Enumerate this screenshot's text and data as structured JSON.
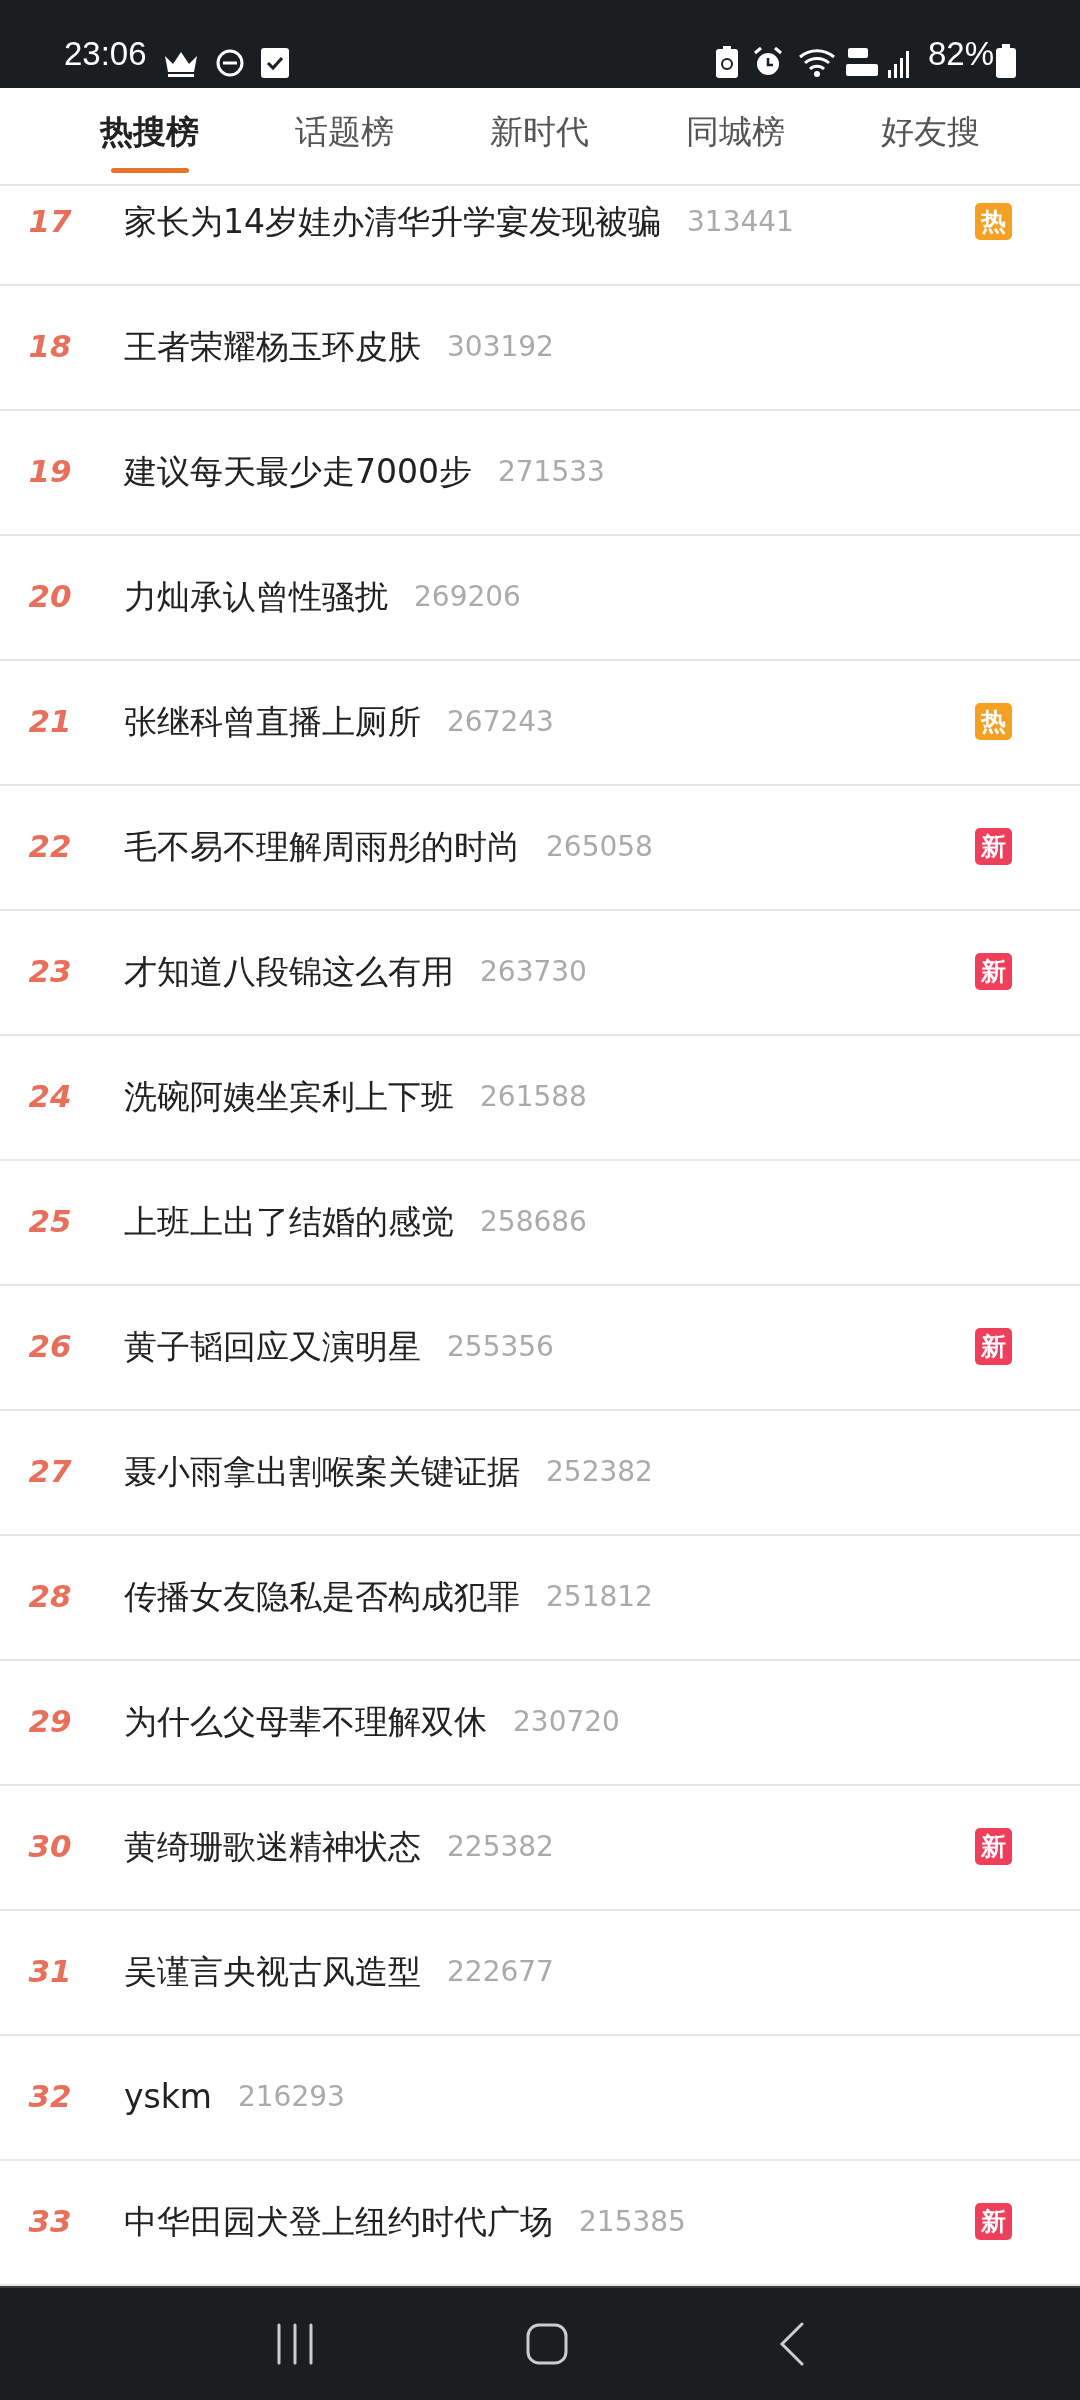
{
  "status_bar": {
    "time": "23:06",
    "battery": "82%"
  },
  "tabs": [
    {
      "label": "热搜榜",
      "selected": true
    },
    {
      "label": "话题榜",
      "selected": false
    },
    {
      "label": "新时代",
      "selected": false
    },
    {
      "label": "同城榜",
      "selected": false
    },
    {
      "label": "好友搜",
      "selected": false
    }
  ],
  "rows": [
    {
      "rank": "17",
      "title": "家长为14岁娃办清华升学宴发现被骗",
      "count": "313441",
      "badge": {
        "kind": "hot",
        "text": "热"
      }
    },
    {
      "rank": "18",
      "title": "王者荣耀杨玉环皮肤",
      "count": "303192"
    },
    {
      "rank": "19",
      "title": "建议每天最少走7000步",
      "count": "271533"
    },
    {
      "rank": "20",
      "title": "力灿承认曾性骚扰",
      "count": "269206"
    },
    {
      "rank": "21",
      "title": "张继科曾直播上厕所",
      "count": "267243",
      "badge": {
        "kind": "hot",
        "text": "热"
      }
    },
    {
      "rank": "22",
      "title": "毛不易不理解周雨彤的时尚",
      "count": "265058",
      "badge": {
        "kind": "new",
        "text": "新"
      }
    },
    {
      "rank": "23",
      "title": "才知道八段锦这么有用",
      "count": "263730",
      "badge": {
        "kind": "new",
        "text": "新"
      }
    },
    {
      "rank": "24",
      "title": "洗碗阿姨坐宾利上下班",
      "count": "261588"
    },
    {
      "rank": "25",
      "title": "上班上出了结婚的感觉",
      "count": "258686"
    },
    {
      "rank": "26",
      "title": "黄子韬回应又演明星",
      "count": "255356",
      "badge": {
        "kind": "new",
        "text": "新"
      }
    },
    {
      "rank": "27",
      "title": "聂小雨拿出割喉案关键证据",
      "count": "252382"
    },
    {
      "rank": "28",
      "title": "传播女友隐私是否构成犯罪",
      "count": "251812"
    },
    {
      "rank": "29",
      "title": "为什么父母辈不理解双休",
      "count": "230720"
    },
    {
      "rank": "30",
      "title": "黄绮珊歌迷精神状态",
      "count": "225382",
      "badge": {
        "kind": "new",
        "text": "新"
      }
    },
    {
      "rank": "31",
      "title": "吴谨言央视古风造型",
      "count": "222677"
    },
    {
      "rank": "32",
      "title": "yskm",
      "count": "216293"
    },
    {
      "rank": "33",
      "title": "中华田园犬登上纽约时代广场",
      "count": "215385",
      "badge": {
        "kind": "new",
        "text": "新"
      }
    }
  ]
}
